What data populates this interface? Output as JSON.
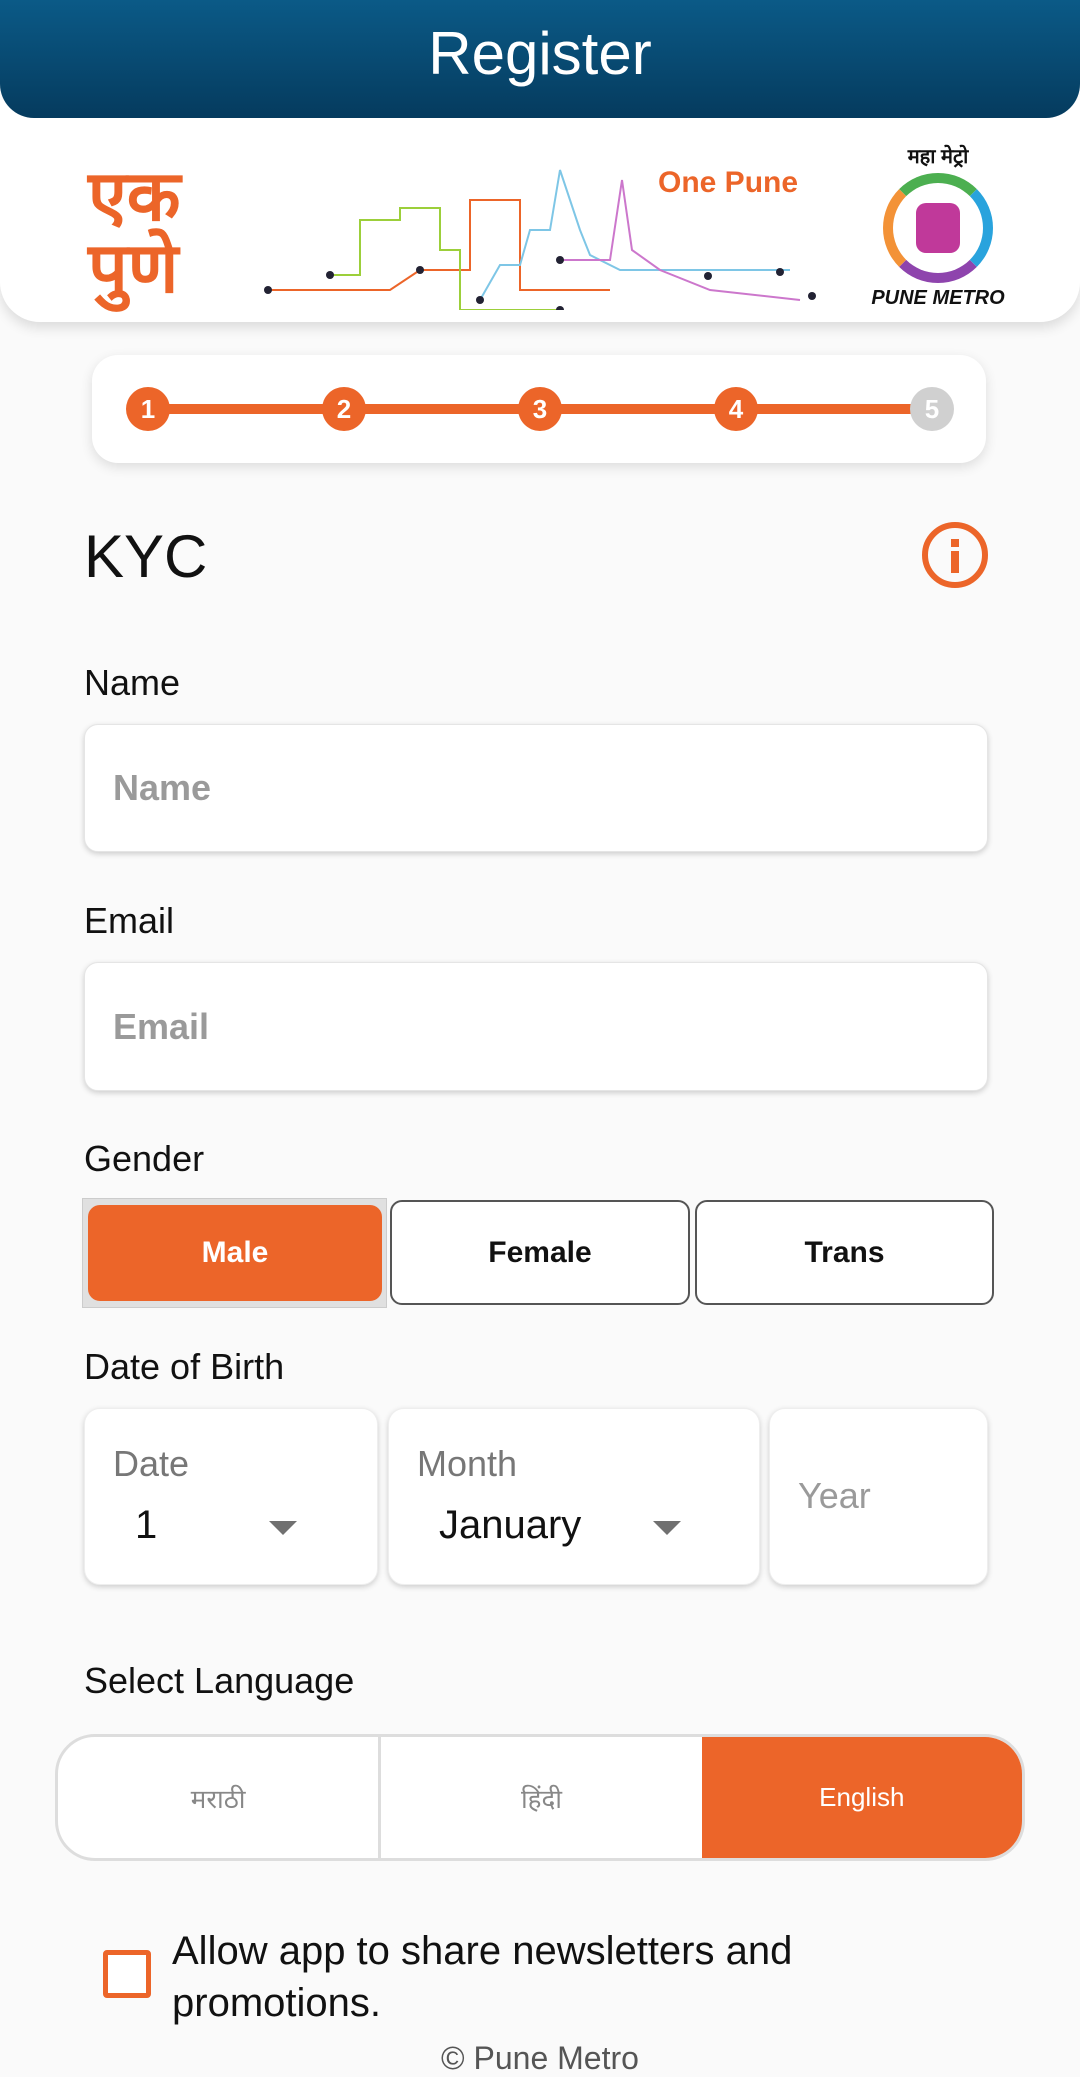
{
  "header": {
    "title": "Register"
  },
  "logos": {
    "left_logo": "एक पुणे",
    "tagline": "One Pune",
    "right_logo_top": "महा मेट्रो",
    "right_logo_bottom": "PUNE METRO"
  },
  "stepper": {
    "steps": [
      "1",
      "2",
      "3",
      "4",
      "5"
    ],
    "current_step": 5,
    "completed_color": "#ec6529",
    "pending_color": "#d0d0d0"
  },
  "section": {
    "title": "KYC",
    "info_icon": "info-circle-icon"
  },
  "form": {
    "name": {
      "label": "Name",
      "placeholder": "Name",
      "value": ""
    },
    "email": {
      "label": "Email",
      "placeholder": "Email",
      "value": ""
    },
    "gender": {
      "label": "Gender",
      "options": [
        "Male",
        "Female",
        "Trans"
      ],
      "selected": "Male"
    },
    "dob": {
      "label": "Date of Birth",
      "date_label": "Date",
      "date_value": "1",
      "month_label": "Month",
      "month_value": "January",
      "year_placeholder": "Year"
    },
    "language": {
      "label": "Select Language",
      "options": [
        "मराठी",
        "हिंदी",
        "English"
      ],
      "selected": "English"
    },
    "newsletter": {
      "label": "Allow app to share newsletters and promotions.",
      "checked": false
    }
  },
  "footer": {
    "copyright": "© Pune Metro"
  },
  "colors": {
    "accent": "#ec6529",
    "header": "#074a72"
  }
}
